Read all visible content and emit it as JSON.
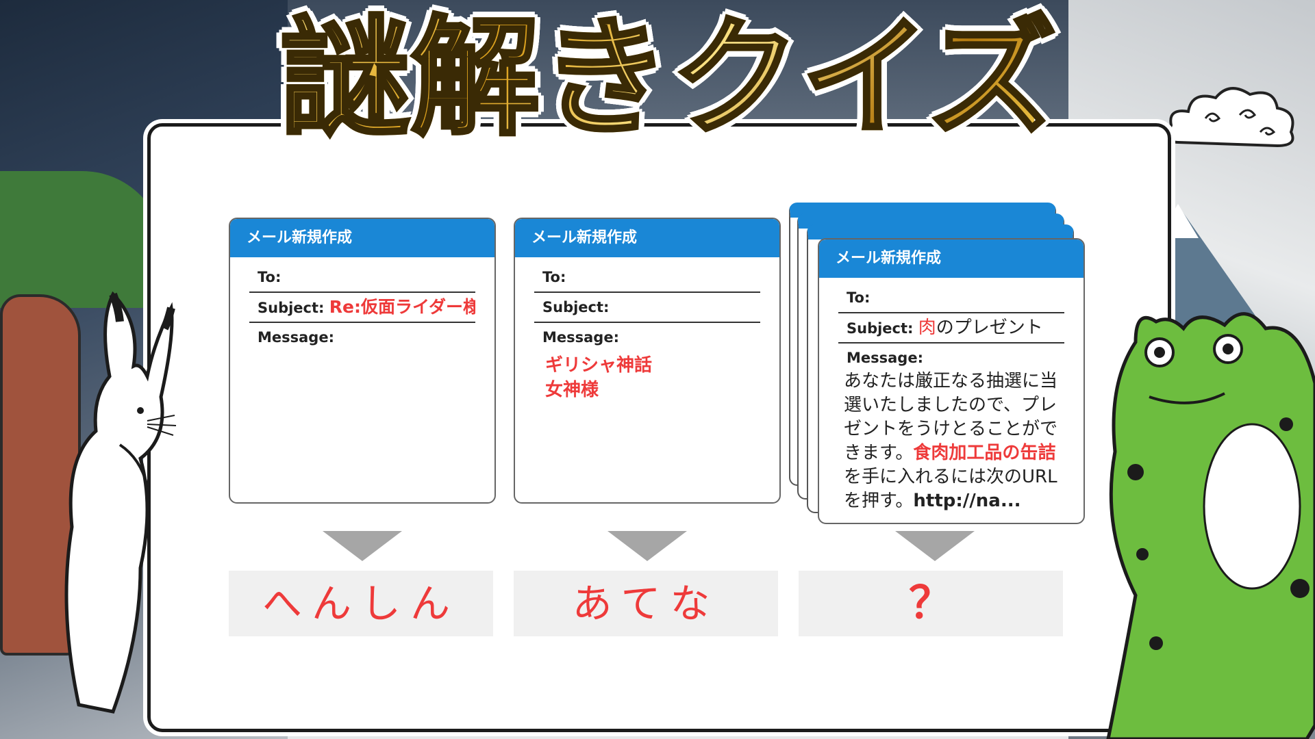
{
  "title": "謎解きクイズ",
  "cards": [
    {
      "header": "メール新規作成",
      "to_label": "To:",
      "subject_label": "Subject:",
      "subject_value": "Re:仮面ライダー様",
      "message_label": "Message:"
    },
    {
      "header": "メール新規作成",
      "to_label": "To:",
      "subject_label": "Subject:",
      "subject_value": "",
      "message_label": "Message:",
      "message_lines": [
        "ギリシャ神話",
        "女神様"
      ]
    },
    {
      "header": "メール新規作成",
      "to_label": "To:",
      "subject_label": "Subject:",
      "subject_red": "肉",
      "subject_black": "のプレゼント",
      "message_label": "Message:",
      "message_part1": "あなたは厳正なる抽選に当選いたしましたので、プレゼントをうけとることができます。",
      "message_red": "食肉加工品の缶詰",
      "message_part2": "を手に入れるには次のURLを押す。",
      "message_url": "http://na..."
    }
  ],
  "answers": [
    "へんしん",
    "あてな",
    "？"
  ],
  "colors": {
    "header_blue": "#1a87d6",
    "accent_red": "#ee3a3a",
    "answer_bg": "#f0f0f0",
    "arrow_gray": "#a6a6a6"
  },
  "icons": [
    "rabbit-illustration",
    "frog-illustration",
    "cloud-icon",
    "mountain-icon",
    "tree-icon"
  ]
}
